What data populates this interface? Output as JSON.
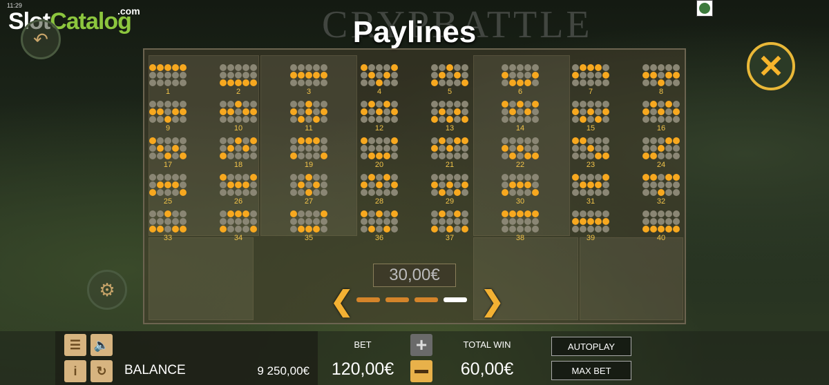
{
  "status_bar": {
    "time": "11:29"
  },
  "watermark": {
    "slot": "Slot",
    "catalog": "Catalog",
    "com": ".com"
  },
  "game_title": "CRYPBATTLE",
  "page_title": "Paylines",
  "paylines": [
    {
      "num": "1",
      "rows": [
        "11111",
        "00000",
        "00000"
      ]
    },
    {
      "num": "2",
      "rows": [
        "00000",
        "00000",
        "11111"
      ]
    },
    {
      "num": "3",
      "rows": [
        "00000",
        "11111",
        "00000"
      ]
    },
    {
      "num": "4",
      "rows": [
        "10001",
        "01010",
        "00100"
      ]
    },
    {
      "num": "5",
      "rows": [
        "00100",
        "01010",
        "10001"
      ]
    },
    {
      "num": "6",
      "rows": [
        "00000",
        "10001",
        "01110"
      ]
    },
    {
      "num": "7",
      "rows": [
        "01110",
        "10001",
        "00000"
      ]
    },
    {
      "num": "8",
      "rows": [
        "00000",
        "11011",
        "00100"
      ]
    },
    {
      "num": "9",
      "rows": [
        "00000",
        "11011",
        "00100"
      ]
    },
    {
      "num": "10",
      "rows": [
        "00100",
        "11011",
        "00000"
      ]
    },
    {
      "num": "11",
      "rows": [
        "00100",
        "10101",
        "01010"
      ]
    },
    {
      "num": "12",
      "rows": [
        "01010",
        "10101",
        "00000"
      ]
    },
    {
      "num": "13",
      "rows": [
        "00000",
        "01010",
        "10101"
      ]
    },
    {
      "num": "14",
      "rows": [
        "10101",
        "01010",
        "00000"
      ]
    },
    {
      "num": "15",
      "rows": [
        "00000",
        "10101",
        "01010"
      ]
    },
    {
      "num": "16",
      "rows": [
        "01010",
        "10101",
        "00000"
      ]
    },
    {
      "num": "17",
      "rows": [
        "10000",
        "01010",
        "00101"
      ]
    },
    {
      "num": "18",
      "rows": [
        "00101",
        "01010",
        "10000"
      ]
    },
    {
      "num": "19",
      "rows": [
        "01110",
        "00000",
        "10001"
      ]
    },
    {
      "num": "20",
      "rows": [
        "10001",
        "00000",
        "01110"
      ]
    },
    {
      "num": "21",
      "rows": [
        "01011",
        "10100",
        "00000"
      ]
    },
    {
      "num": "22",
      "rows": [
        "00000",
        "10100",
        "01011"
      ]
    },
    {
      "num": "23",
      "rows": [
        "11000",
        "00100",
        "00011"
      ]
    },
    {
      "num": "24",
      "rows": [
        "00011",
        "00100",
        "11000"
      ]
    },
    {
      "num": "25",
      "rows": [
        "00000",
        "01110",
        "10001"
      ]
    },
    {
      "num": "26",
      "rows": [
        "10001",
        "01110",
        "00000"
      ]
    },
    {
      "num": "27",
      "rows": [
        "00100",
        "01010",
        "00100"
      ]
    },
    {
      "num": "28",
      "rows": [
        "01010",
        "10101",
        "00000"
      ]
    },
    {
      "num": "29",
      "rows": [
        "00000",
        "10101",
        "01010"
      ]
    },
    {
      "num": "30",
      "rows": [
        "00000",
        "01110",
        "10001"
      ]
    },
    {
      "num": "31",
      "rows": [
        "10001",
        "01110",
        "00000"
      ]
    },
    {
      "num": "32",
      "rows": [
        "11011",
        "00000",
        "00100"
      ]
    },
    {
      "num": "33",
      "rows": [
        "00100",
        "00000",
        "11011"
      ]
    },
    {
      "num": "34",
      "rows": [
        "01110",
        "00000",
        "10001"
      ]
    },
    {
      "num": "35",
      "rows": [
        "10001",
        "00000",
        "01110"
      ]
    },
    {
      "num": "36",
      "rows": [
        "10101",
        "00000",
        "01010"
      ]
    },
    {
      "num": "37",
      "rows": [
        "01010",
        "00000",
        "10101"
      ]
    },
    {
      "num": "38",
      "rows": [
        "11111",
        "00000",
        "00000"
      ]
    },
    {
      "num": "39",
      "rows": [
        "00000",
        "11111",
        "00000"
      ]
    },
    {
      "num": "40",
      "rows": [
        "00000",
        "00000",
        "11111"
      ]
    }
  ],
  "colors": {
    "dot_on": "#f7a81f",
    "dot_off": "#8a8674",
    "accent": "#f7b52c"
  },
  "center_amount": "30,00€",
  "pager": {
    "pages": 4,
    "active": 3
  },
  "icons": {
    "close": "close-icon",
    "prev": "chevron-left-icon",
    "next": "chevron-right-icon",
    "menu": "menu-icon",
    "sound": "speaker-icon",
    "info": "info-icon",
    "history": "history-icon",
    "back": "back-arrow-icon",
    "gear": "gear-icon"
  },
  "bottom_bar": {
    "balance_label": "BALANCE",
    "balance_value": "9 250,00€",
    "bet_label": "BET",
    "bet_value": "120,00€",
    "total_win_label": "TOTAL WIN",
    "total_win_value": "60,00€",
    "autoplay_label": "AUTOPLAY",
    "max_bet_label": "MAX BET",
    "info_glyph": "i"
  }
}
